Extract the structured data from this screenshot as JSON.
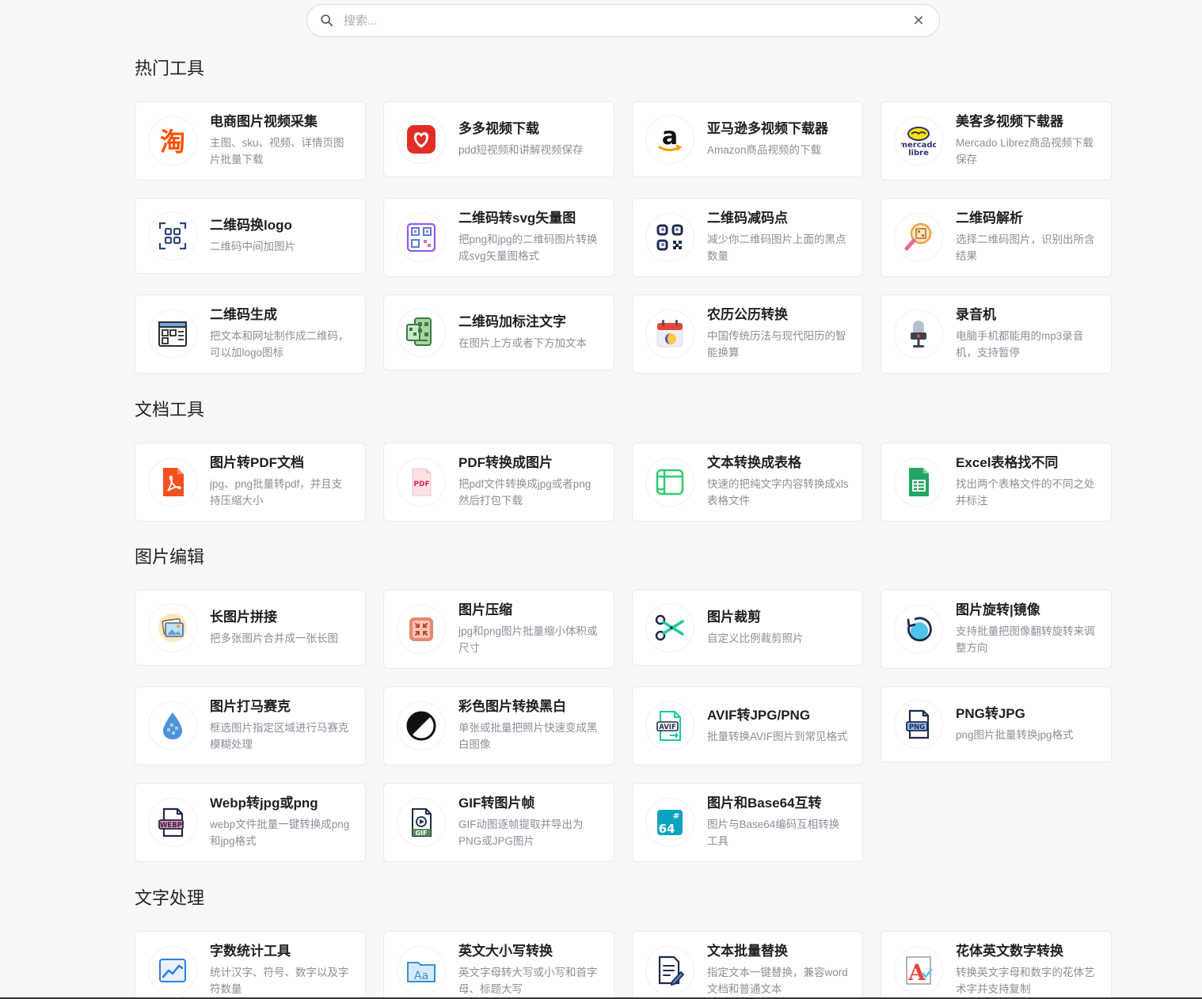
{
  "search": {
    "placeholder": "搜索..."
  },
  "sections": [
    {
      "title": "热门工具",
      "items": [
        {
          "title": "电商图片视频采集",
          "desc": "主图、sku、视频、详情页图片批量下载",
          "icon": "taobao-icon"
        },
        {
          "title": "多多视频下载",
          "desc": "pdd短视频和讲解视频保存",
          "icon": "pinduoduo-icon"
        },
        {
          "title": "亚马逊多视频下载器",
          "desc": "Amazon商品视频的下载",
          "icon": "amazon-icon"
        },
        {
          "title": "美客多视频下载器",
          "desc": "Mercado Librez商品视频下载保存",
          "icon": "mercado-libre-icon"
        },
        {
          "title": "二维码换logo",
          "desc": "二维码中间加图片",
          "icon": "qr-scan-icon"
        },
        {
          "title": "二维码转svg矢量图",
          "desc": "把png和jpg的二维码图片转换成svg矢量图格式",
          "icon": "qr-svg-icon"
        },
        {
          "title": "二维码减码点",
          "desc": "减少你二维码图片上面的黑点数量",
          "icon": "qr-dots-icon"
        },
        {
          "title": "二维码解析",
          "desc": "选择二维码图片，识别出所含结果",
          "icon": "qr-magnifier-icon"
        },
        {
          "title": "二维码生成",
          "desc": "把文本和网址制作成二维码，可以加logo图标",
          "icon": "qr-generator-icon"
        },
        {
          "title": "二维码加标注文字",
          "desc": "在图片上方或者下方加文本",
          "icon": "qr-label-icon"
        },
        {
          "title": "农历公历转换",
          "desc": "中国传统历法与现代阳历的智能换算",
          "icon": "calendar-icon"
        },
        {
          "title": "录音机",
          "desc": "电脑手机都能用的mp3录音机，支持暂停",
          "icon": "microphone-icon"
        }
      ]
    },
    {
      "title": "文档工具",
      "items": [
        {
          "title": "图片转PDF文档",
          "desc": "jpg、png批量转pdf，并且支持压缩大小",
          "icon": "pdf-icon"
        },
        {
          "title": "PDF转换成图片",
          "desc": "把pdf文件转换成jpg或者png然后打包下载",
          "icon": "pdf-file-icon"
        },
        {
          "title": "文本转换成表格",
          "desc": "快速的把纯文字内容转换成xls表格文件",
          "icon": "table-icon"
        },
        {
          "title": "Excel表格找不同",
          "desc": "找出两个表格文件的不同之处并标注",
          "icon": "sheet-icon"
        }
      ]
    },
    {
      "title": "图片编辑",
      "items": [
        {
          "title": "长图片拼接",
          "desc": "把多张图片合并成一张长图",
          "icon": "image-stitch-icon"
        },
        {
          "title": "图片压缩",
          "desc": "jpg和png图片批量缩小体积或尺寸",
          "icon": "compress-icon"
        },
        {
          "title": "图片裁剪",
          "desc": "自定义比例裁剪照片",
          "icon": "scissors-icon"
        },
        {
          "title": "图片旋转|镜像",
          "desc": "支持批量把图像翻转旋转来调整方向",
          "icon": "rotate-icon"
        },
        {
          "title": "图片打马赛克",
          "desc": "框选图片指定区域进行马赛克模糊处理",
          "icon": "drop-icon"
        },
        {
          "title": "彩色图片转换黑白",
          "desc": "单张或批量把照片快速变成黑白图像",
          "icon": "contrast-icon"
        },
        {
          "title": "AVIF转JPG/PNG",
          "desc": "批量转换AVIF图片到常见格式",
          "icon": "avif-icon"
        },
        {
          "title": "PNG转JPG",
          "desc": "png图片批量转换jpg格式",
          "icon": "png-icon"
        },
        {
          "title": "Webp转jpg或png",
          "desc": "webp文件批量一键转换成png和jpg格式",
          "icon": "webp-icon"
        },
        {
          "title": "GIF转图片帧",
          "desc": "GIF动图逐帧提取并导出为PNG或JPG图片",
          "icon": "gif-icon"
        },
        {
          "title": "图片和Base64互转",
          "desc": "图片与Base64编码互相转换工具",
          "icon": "base64-icon"
        }
      ]
    },
    {
      "title": "文字处理",
      "items": [
        {
          "title": "字数统计工具",
          "desc": "统计汉字、符号、数字以及字符数量",
          "icon": "chart-line-icon"
        },
        {
          "title": "英文大小写转换",
          "desc": "英文字母转大写或小写和首字母、标题大写",
          "icon": "folder-aa-icon"
        },
        {
          "title": "文本批量替换",
          "desc": "指定文本一键替换，兼容word文档和普通文本",
          "icon": "edit-doc-icon"
        },
        {
          "title": "花体英文数字转换",
          "desc": "转换英文字母和数字的花体艺术字并支持复制",
          "icon": "fancy-a-icon"
        }
      ]
    }
  ]
}
